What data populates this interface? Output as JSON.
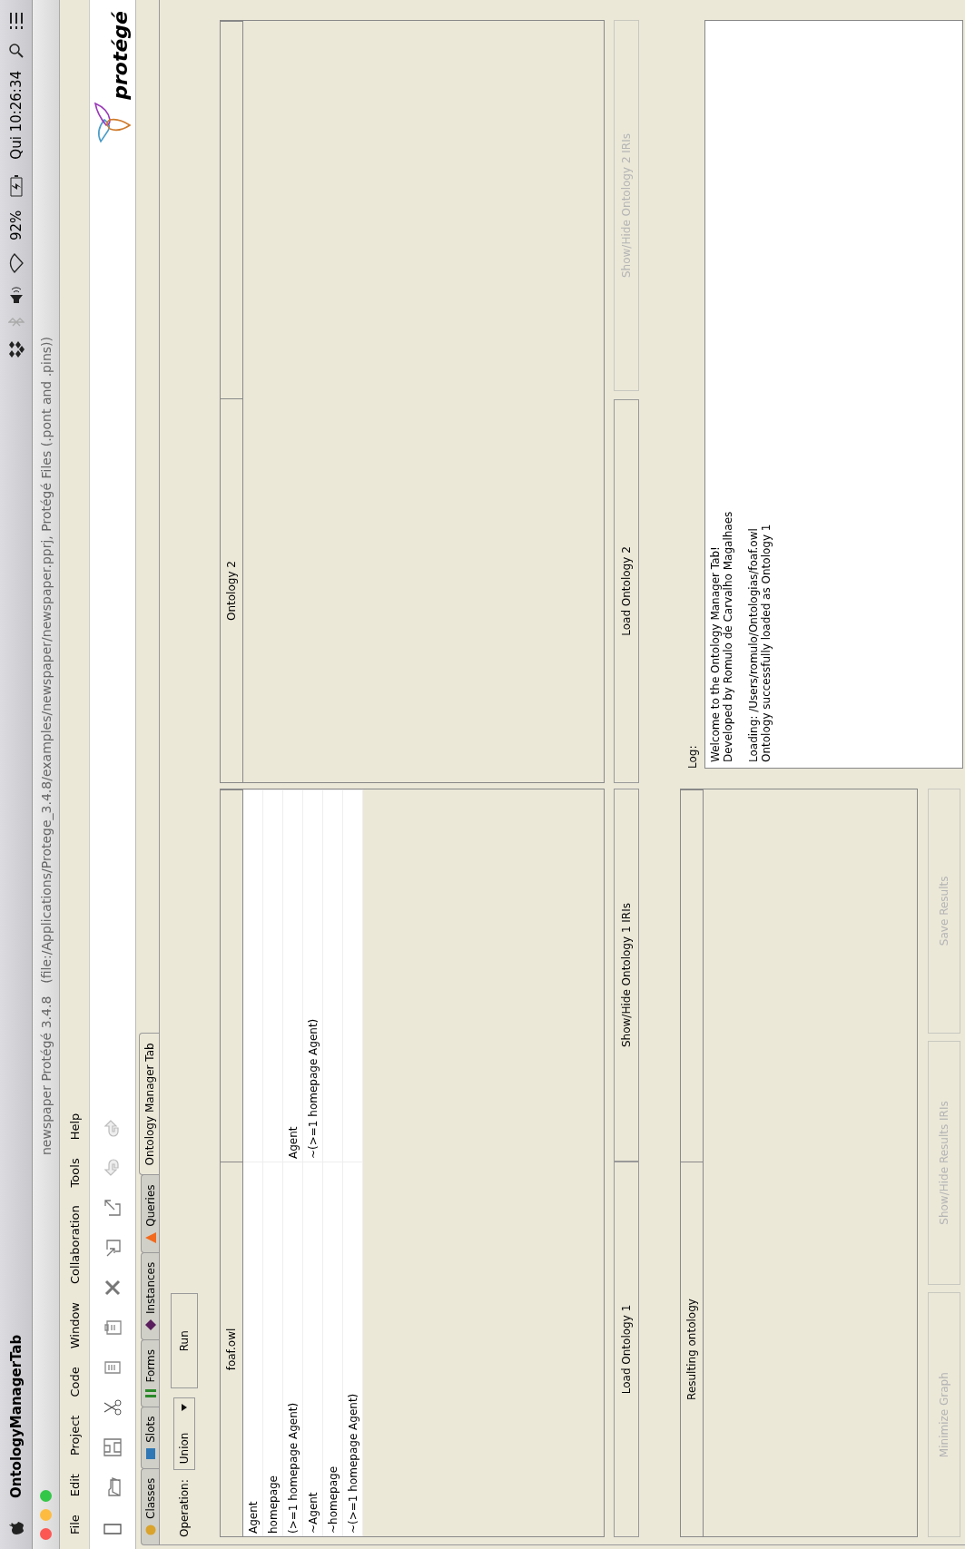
{
  "menu_bar": {
    "app_name": "OntologyManagerTab",
    "battery": "92%",
    "clock": "Qui 10:26:34"
  },
  "window": {
    "title_project": "newspaper",
    "title_app": "Protégé 3.4.8",
    "title_path": "(file:/Applications/Protege_3.4.8/examples/newspaper/newspaper.pprj, Protégé Files (.pont and .pins))"
  },
  "menus": [
    "File",
    "Edit",
    "Project",
    "Code",
    "Window",
    "Collaboration",
    "Tools",
    "Help"
  ],
  "toolbar": {
    "logo": "protégé"
  },
  "tabs": [
    {
      "label": "Classes",
      "kind": "circle",
      "selected": false
    },
    {
      "label": "Slots",
      "kind": "square",
      "selected": false
    },
    {
      "label": "Forms",
      "kind": "bars",
      "selected": false
    },
    {
      "label": "Instances",
      "kind": "diamond",
      "selected": false
    },
    {
      "label": "Queries",
      "kind": "triangle",
      "selected": false
    },
    {
      "label": "Ontology Manager Tab",
      "kind": "none",
      "selected": true
    }
  ],
  "operation": {
    "label": "Operation:",
    "value": "Union",
    "run": "Run"
  },
  "ontology1": {
    "header": "foaf.owl",
    "entries": [
      {
        "name": "Agent"
      },
      {
        "name": "homepage"
      },
      {
        "name": "(>=1 homepage Agent)",
        "column_2": "Agent"
      },
      {
        "name": "~Agent",
        "column_2": "~(>=1 homepage Agent)"
      },
      {
        "name": "~homepage"
      },
      {
        "name": "~(>=1 homepage Agent)"
      }
    ]
  },
  "ontology2": {
    "header": "Ontology 2"
  },
  "buttons": [
    {
      "label": "Load Ontology 1",
      "disabled": false
    },
    {
      "label": "Show/Hide Ontology 1 IRIs",
      "disabled": false
    },
    {
      "label": "Load Ontology 2",
      "disabled": false
    },
    {
      "label": "Show/Hide Ontology 2 IRIs",
      "disabled": true
    }
  ],
  "result": {
    "header": "Resulting ontology"
  },
  "result_buttons": [
    {
      "label": "Minimize Graph",
      "disabled": true
    },
    {
      "label": "Show/Hide Results IRIs",
      "disabled": true
    },
    {
      "label": "Save Results",
      "disabled": true
    }
  ],
  "log": {
    "label": "Log:",
    "paragraphs": [
      [
        "Welcome to the Ontology Manager Tab!",
        "Developed by Romulo de Carvalho Magalhaes"
      ],
      [
        "Loading: /Users/romulo/Ontologias/foaf.owl",
        "Ontology successfully loaded as Ontology 1"
      ]
    ]
  }
}
